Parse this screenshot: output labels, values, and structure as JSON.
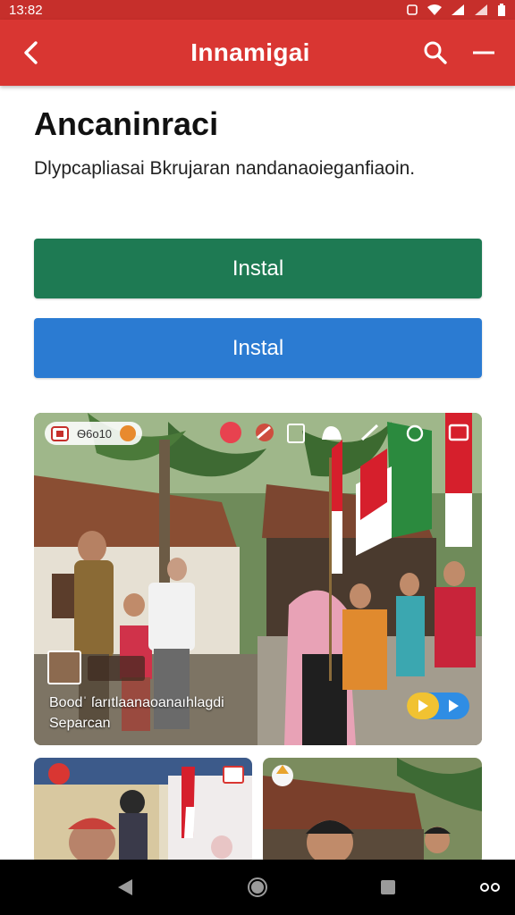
{
  "status_bar": {
    "time": "13:82"
  },
  "app_bar": {
    "title": "Innamigai"
  },
  "main": {
    "heading": "Ancaninraci",
    "subtitle": "Dlypcapliasai Bkrujaran nandanaoieganfiaoin."
  },
  "buttons": [
    {
      "label": "Instal",
      "color": "#1e7a53"
    },
    {
      "label": "Instal",
      "color": "#2b7bd2"
    }
  ],
  "feature_card": {
    "pill_text": "Ѳ6ᴏ10",
    "caption_line1": "Boodˈ ſarıtlaanaoanaıhlagdi",
    "caption_line2": "Separcan"
  },
  "colors": {
    "primary": "#d93632",
    "status": "#c62f2b"
  }
}
